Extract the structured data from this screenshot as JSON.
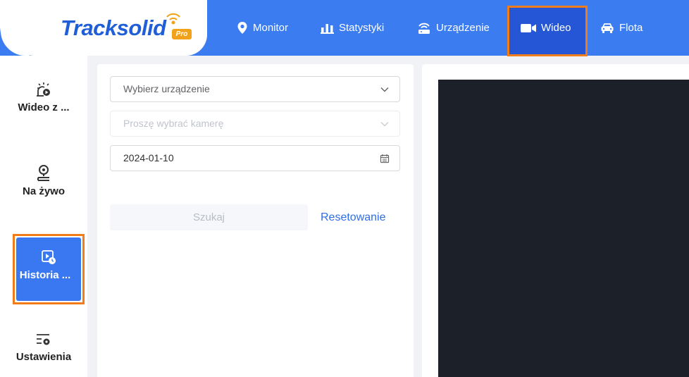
{
  "logo": {
    "text": "Tracksolid",
    "badge": "Pro"
  },
  "nav": {
    "monitor": "Monitor",
    "stats": "Statystyki",
    "device": "Urządzenie",
    "video": "Wideo",
    "fleet": "Flota"
  },
  "sidebar": {
    "live_video": "Wideo z ...",
    "live": "Na żywo",
    "history": "Historia ...",
    "settings": "Ustawienia"
  },
  "form": {
    "device_placeholder": "Wybierz urządzenie",
    "camera_placeholder": "Proszę wybrać kamerę",
    "date_value": "2024-01-10",
    "search_label": "Szukaj",
    "reset_label": "Resetowanie"
  },
  "colors": {
    "topbar": "#3b7cf0",
    "highlight": "#f07c1a",
    "active": "#3a78f2",
    "video_bg": "#1c2029"
  }
}
